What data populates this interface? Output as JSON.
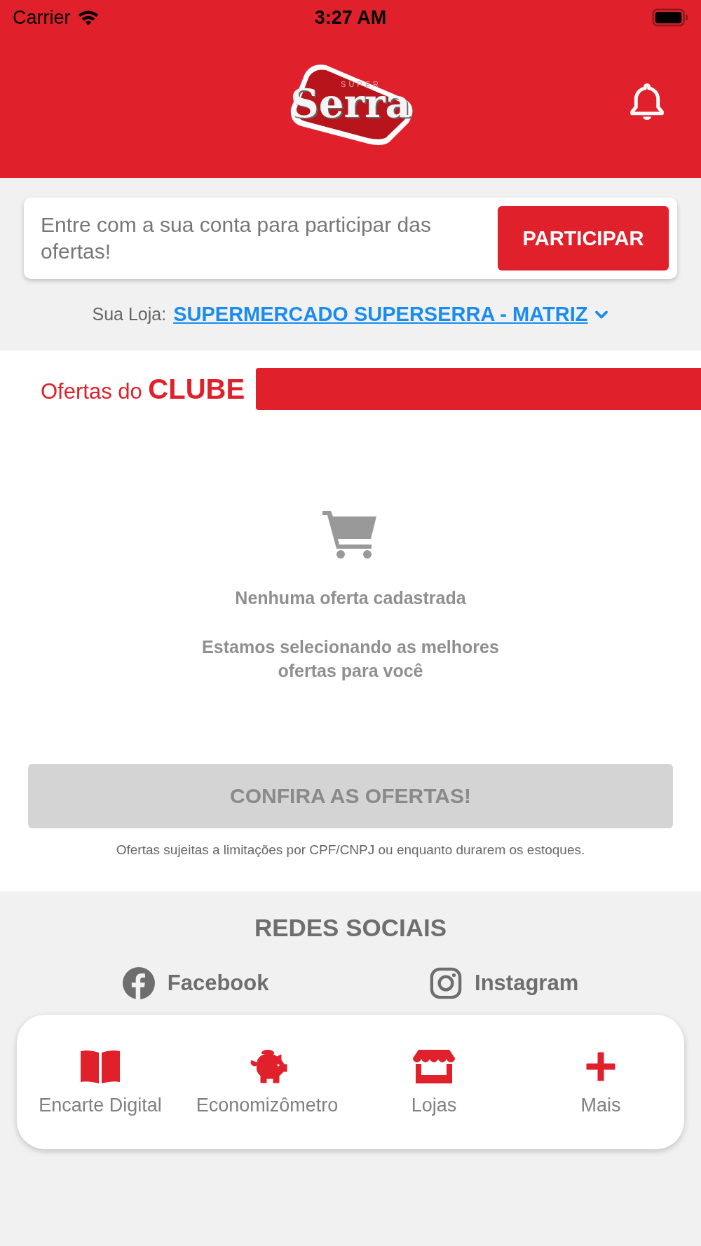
{
  "status_bar": {
    "carrier": "Carrier",
    "time": "3:27 AM"
  },
  "header": {
    "logo": {
      "small": "SUPER",
      "big": "Serra"
    }
  },
  "login_card": {
    "message": "Entre com a sua conta para participar das ofertas!",
    "button": "PARTICIPAR"
  },
  "store": {
    "label": "Sua Loja:",
    "name": "SUPERMERCADO SUPERSERRA - MATRIZ"
  },
  "club": {
    "title_prefix": "Ofertas do",
    "title_strong": "CLUBE"
  },
  "empty_state": {
    "title": "Nenhuma oferta cadastrada",
    "subtitle": "Estamos selecionando as melhores ofertas para você"
  },
  "offers_button": {
    "label": "CONFIRA AS OFERTAS!",
    "disabled": true
  },
  "disclaimer": "Ofertas sujeitas a limitações por CPF/CNPJ ou enquanto durarem os estoques.",
  "social": {
    "title": "REDES SOCIAIS",
    "links": [
      {
        "kind": "facebook",
        "label": "Facebook"
      },
      {
        "kind": "instagram",
        "label": "Instagram"
      }
    ]
  },
  "bottom_nav": [
    {
      "kind": "book",
      "label": "Encarte Digital"
    },
    {
      "kind": "piggy",
      "label": "Economizômetro"
    },
    {
      "kind": "store",
      "label": "Lojas"
    },
    {
      "kind": "plus",
      "label": "Mais"
    }
  ]
}
